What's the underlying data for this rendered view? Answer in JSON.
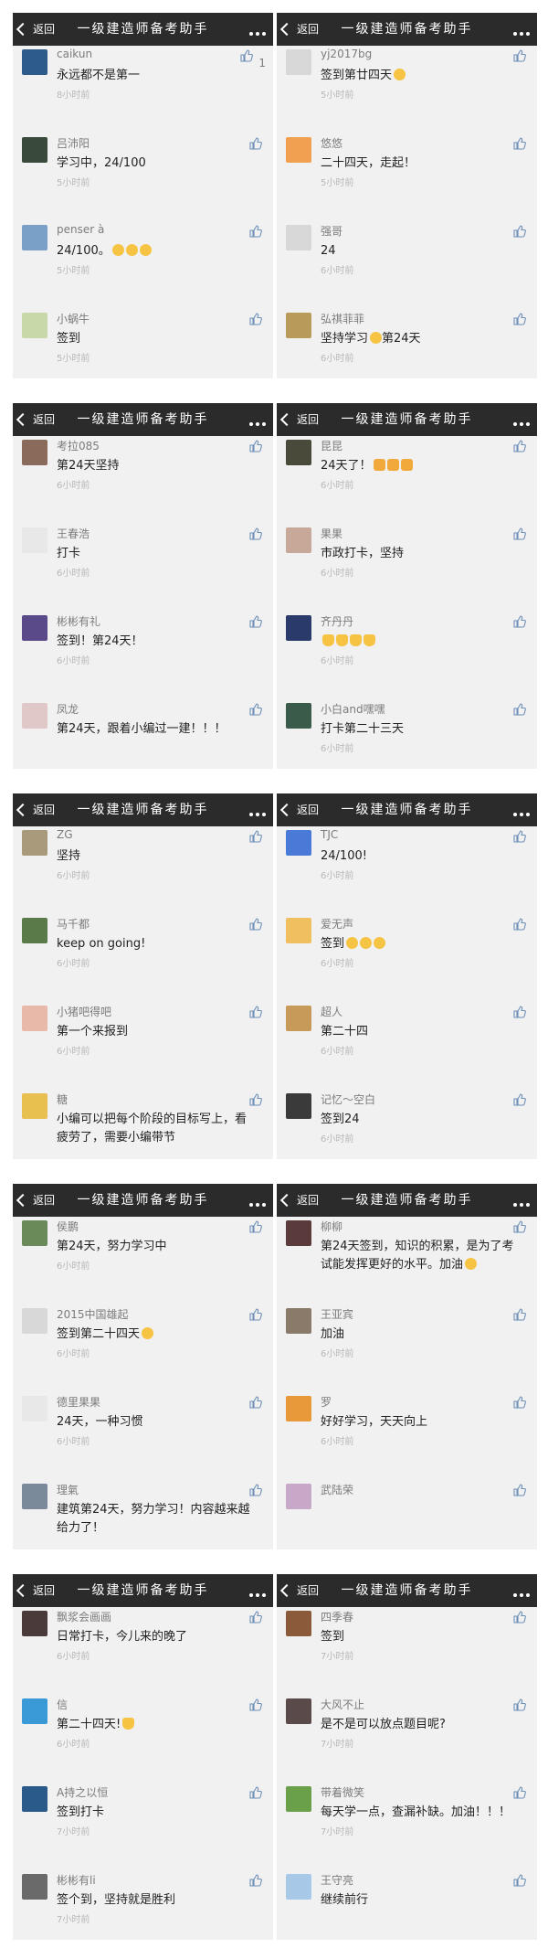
{
  "common": {
    "back_label": "返回",
    "title": "一级建造师备考助手"
  },
  "panels": [
    {
      "items": [
        {
          "name": "caikun",
          "content": "永远都不是第一",
          "time": "8小时前",
          "likes": "1",
          "avatar_color": "#2e5c8a"
        },
        {
          "name": "吕沛阳",
          "content": "学习中，24/100",
          "time": "5小时前",
          "avatar_color": "#3a4a3a"
        },
        {
          "name": "penser à",
          "content": "24/100。",
          "emoji": [
            "grin-emoji",
            "grin-emoji",
            "grin-emoji"
          ],
          "time": "5小时前",
          "avatar_color": "#7aa0c8"
        },
        {
          "name": "小蜗牛",
          "content": "签到",
          "time": "5小时前",
          "avatar_color": "#c8d8a8"
        }
      ]
    },
    {
      "items": [
        {
          "name": "yj2017bg",
          "content": "签到第廿四天",
          "emoji": [
            "smile-emoji"
          ],
          "time": "5小时前",
          "avatar_color": "#d8d8d8"
        },
        {
          "name": "悠悠",
          "content": "二十四天，走起！",
          "time": "5小时前",
          "avatar_color": "#f0a050"
        },
        {
          "name": "强哥",
          "content": "24",
          "time": "6小时前",
          "avatar_color": "#d8d8d8"
        },
        {
          "name": "弘祺菲菲",
          "content": "坚持学习",
          "content_after": "第24天",
          "emoji": [
            "smile-emoji"
          ],
          "time": "6小时前",
          "avatar_color": "#b89a5a"
        }
      ]
    },
    {
      "items": [
        {
          "name": "考拉085",
          "content": "第24天坚持",
          "time": "6小时前",
          "avatar_color": "#8a6a5a"
        },
        {
          "name": "王春浩",
          "content": "打卡",
          "time": "6小时前",
          "avatar_color": "#e8e8e8"
        },
        {
          "name": "彬彬有礼",
          "content": "签到！第24天！",
          "time": "6小时前",
          "avatar_color": "#5a4a8a"
        },
        {
          "name": "凤龙",
          "content": "第24天，跟着小编过一建！！！",
          "time": "",
          "avatar_color": "#e0c8c8"
        }
      ]
    },
    {
      "items": [
        {
          "name": "昆昆",
          "content": "24天了！",
          "emoji": [
            "fist-emoji",
            "fist-emoji",
            "fist-emoji"
          ],
          "time": "6小时前",
          "avatar_color": "#4a4a3a"
        },
        {
          "name": "果果",
          "content": "市政打卡，坚持",
          "time": "6小时前",
          "avatar_color": "#c8a898"
        },
        {
          "name": "齐丹丹",
          "content": "",
          "emoji": [
            "thumb-emoji",
            "thumb-emoji",
            "thumb-emoji",
            "thumb-emoji"
          ],
          "time": "6小时前",
          "avatar_color": "#2a3a6a"
        },
        {
          "name": "小白and嘿嘿",
          "content": "打卡第二十三天",
          "time": "6小时前",
          "avatar_color": "#3a5a4a"
        }
      ]
    },
    {
      "items": [
        {
          "name": "ZG",
          "content": "坚持",
          "time": "6小时前",
          "avatar_color": "#a89a7a"
        },
        {
          "name": "马千都",
          "content": "keep on going!",
          "time": "6小时前",
          "avatar_color": "#5a7a4a"
        },
        {
          "name": "小猪吧得吧",
          "content": "第一个来报到",
          "time": "6小时前",
          "avatar_color": "#e8b8a8"
        },
        {
          "name": "糖",
          "content": "小编可以把每个阶段的目标写上，看疲劳了，需要小编带节",
          "time": "",
          "avatar_color": "#e8c050"
        }
      ]
    },
    {
      "items": [
        {
          "name": "TJC",
          "content": "24/100!",
          "time": "6小时前",
          "avatar_color": "#4a7ad8"
        },
        {
          "name": "爱无声",
          "content": "签到",
          "emoji": [
            "smile-emoji",
            "smile-emoji",
            "smile-emoji"
          ],
          "time": "6小时前",
          "avatar_color": "#f0c060"
        },
        {
          "name": "超人",
          "content": "第二十四",
          "time": "6小时前",
          "avatar_color": "#c89a5a"
        },
        {
          "name": "记忆～空白",
          "content": "签到24",
          "time": "6小时前",
          "avatar_color": "#3a3a3a"
        }
      ]
    },
    {
      "items": [
        {
          "name": "侯鹏",
          "content": "第24天，努力学习中",
          "time": "6小时前",
          "avatar_color": "#6a8a5a"
        },
        {
          "name": "2015中国雄起",
          "content": "签到第二十四天",
          "emoji": [
            "smile-emoji"
          ],
          "time": "6小时前",
          "avatar_color": "#d8d8d8"
        },
        {
          "name": "德里果果",
          "content": "24天，一种习惯",
          "time": "6小时前",
          "avatar_color": "#e8e8e8"
        },
        {
          "name": "理氣",
          "content": "建筑第24天，努力学习！内容越来越给力了！",
          "time": "",
          "avatar_color": "#7a8a9a"
        }
      ]
    },
    {
      "items": [
        {
          "name": "柳柳",
          "content": "第24天签到，知识的积累，是为了考试能发挥更好的水平。加油",
          "emoji": [
            "smile-emoji"
          ],
          "time": "",
          "avatar_color": "#5a3a3a"
        },
        {
          "name": "王亚宾",
          "content": "加油",
          "time": "6小时前",
          "avatar_color": "#8a7a6a"
        },
        {
          "name": "罗",
          "content": "好好学习，天天向上",
          "time": "6小时前",
          "avatar_color": "#e89a3a"
        },
        {
          "name": "武陆荣",
          "content": "",
          "time": "",
          "avatar_color": "#c8a8c8"
        }
      ]
    },
    {
      "items": [
        {
          "name": "飘浆会画画",
          "content": "日常打卡，今儿来的晚了",
          "time": "6小时前",
          "avatar_color": "#4a3a3a"
        },
        {
          "name": "信",
          "content": "第二十四天!",
          "emoji": [
            "thumb-emoji"
          ],
          "time": "6小时前",
          "avatar_color": "#3a9ad8"
        },
        {
          "name": "A持之以恒",
          "content": "签到打卡",
          "time": "7小时前",
          "avatar_color": "#2a5a8a"
        },
        {
          "name": "彬彬有li",
          "content": "签个到，坚持就是胜利",
          "time": "7小时前",
          "avatar_color": "#6a6a6a"
        }
      ]
    },
    {
      "items": [
        {
          "name": "四季春",
          "content": "签到",
          "time": "7小时前",
          "avatar_color": "#8a5a3a"
        },
        {
          "name": "大风不止",
          "content": "是不是可以放点题目呢?",
          "time": "7小时前",
          "avatar_color": "#5a4a4a"
        },
        {
          "name": "带着微笑",
          "content": "每天学一点，查漏补缺。加油！！！",
          "time": "7小时前",
          "avatar_color": "#6aa04a"
        },
        {
          "name": "王守亮",
          "content": "继续前行",
          "time": "",
          "avatar_color": "#a8c8e8"
        }
      ]
    }
  ]
}
